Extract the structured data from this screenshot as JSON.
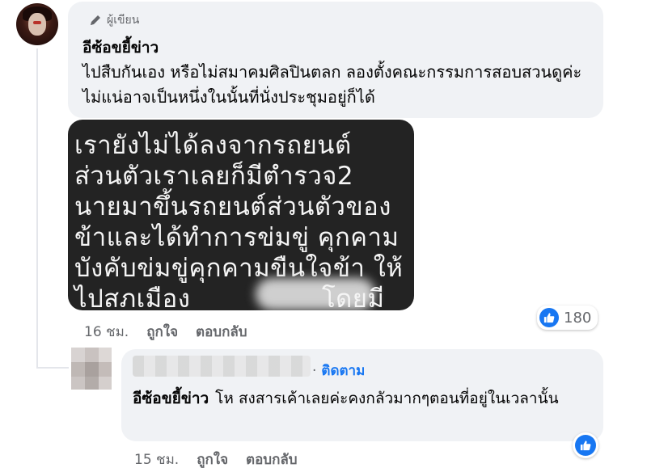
{
  "comment": {
    "author_badge": "ผู้เขียน",
    "author_name": "อีซ้อขยี้ข่าว",
    "text": "ไปสืบกันเอง หรือไม่สมาคมศิลปินตลก ลองตั้งคณะกรรมการสอบสวนดูค่ะไม่แน่อาจเป็นหนึ่งในนั้นที่นั่งประชุมอยู่ก็ได้",
    "image_lines": [
      "เรายังไม่ได้ลงจากรถยนต์",
      "ส่วนตัวเราเลยก็มีตำรวจ2",
      "นายมาขึ้นรถยนต์ส่วนตัวของ",
      "ข้าและได้ทำการข่มขู่ คุกคาม",
      "บังคับข่มขู่คุกคามขืนใจข้า ให้",
      "ไปสภเมือง",
      "โดยมี"
    ],
    "reaction_count": "180",
    "time": "16 ชม.",
    "like_label": "ถูกใจ",
    "reply_label": "ตอบกลับ"
  },
  "reply": {
    "follow_label": "ติดตาม",
    "mention": "อีซ้อขยี้ข่าว",
    "text": "โห สงสารเค้าเลยค่ะคงกลัวมากๆตอนที่อยู่ในเวลานั้น",
    "time": "15 ชม.",
    "like_label": "ถูกใจ",
    "reply_label": "ตอบกลับ"
  },
  "icons": {
    "author_badge": "pen-icon",
    "reaction": "thumbs-up-icon"
  },
  "colors": {
    "accent": "#1877f2",
    "bubble": "#f0f2f5",
    "muted_text": "#65676b"
  }
}
